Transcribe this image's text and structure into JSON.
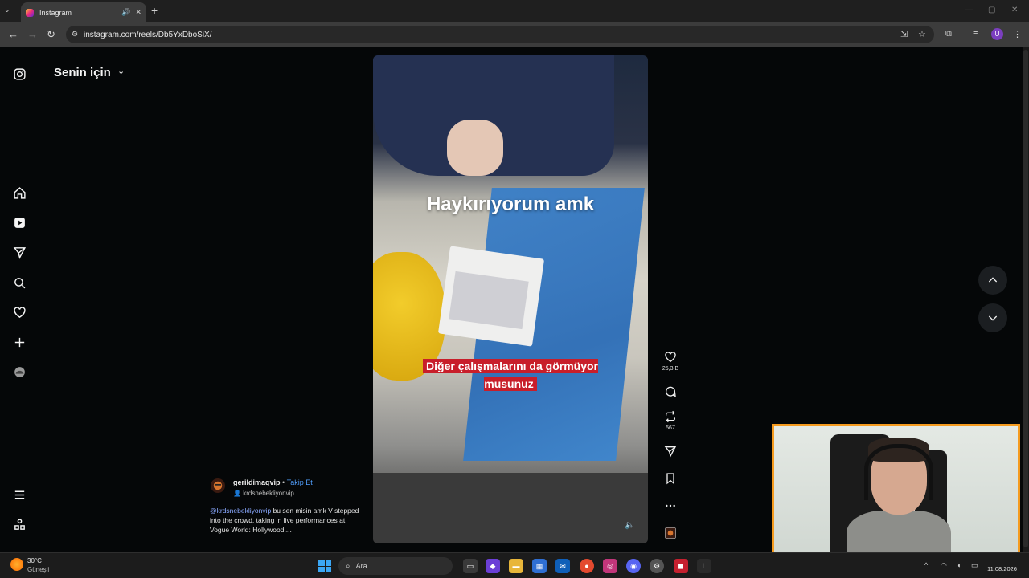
{
  "browser": {
    "tab_title": "Instagram",
    "url": "instagram.com/reels/Db5YxDboSiX/",
    "profile_initial": "U"
  },
  "feed": {
    "title": "Senin için"
  },
  "reel": {
    "caption_top": "Haykırıyorum amk",
    "caption_bottom": "Diğer çalışmalarını da görmüyor musunuz",
    "likes": "25,3 B",
    "reposts": "567"
  },
  "post": {
    "username": "gerildimaqvip",
    "separator": "•",
    "follow_label": "Takip Et",
    "audio": "krdsnebekliyonvip",
    "mention": "@krdsnebekliyonvip",
    "description": "bu sen misin amk V stepped into the crowd, taking in live performances at Vogue World: Hollywood...."
  },
  "taskbar": {
    "temperature": "30°C",
    "condition": "Güneşli",
    "search_placeholder": "Ara",
    "date": "11.08.2026"
  },
  "colors": {
    "follow": "#4f9cf9",
    "webcam_border": "#f59b1f",
    "caption_bg": "#c81e2a"
  }
}
